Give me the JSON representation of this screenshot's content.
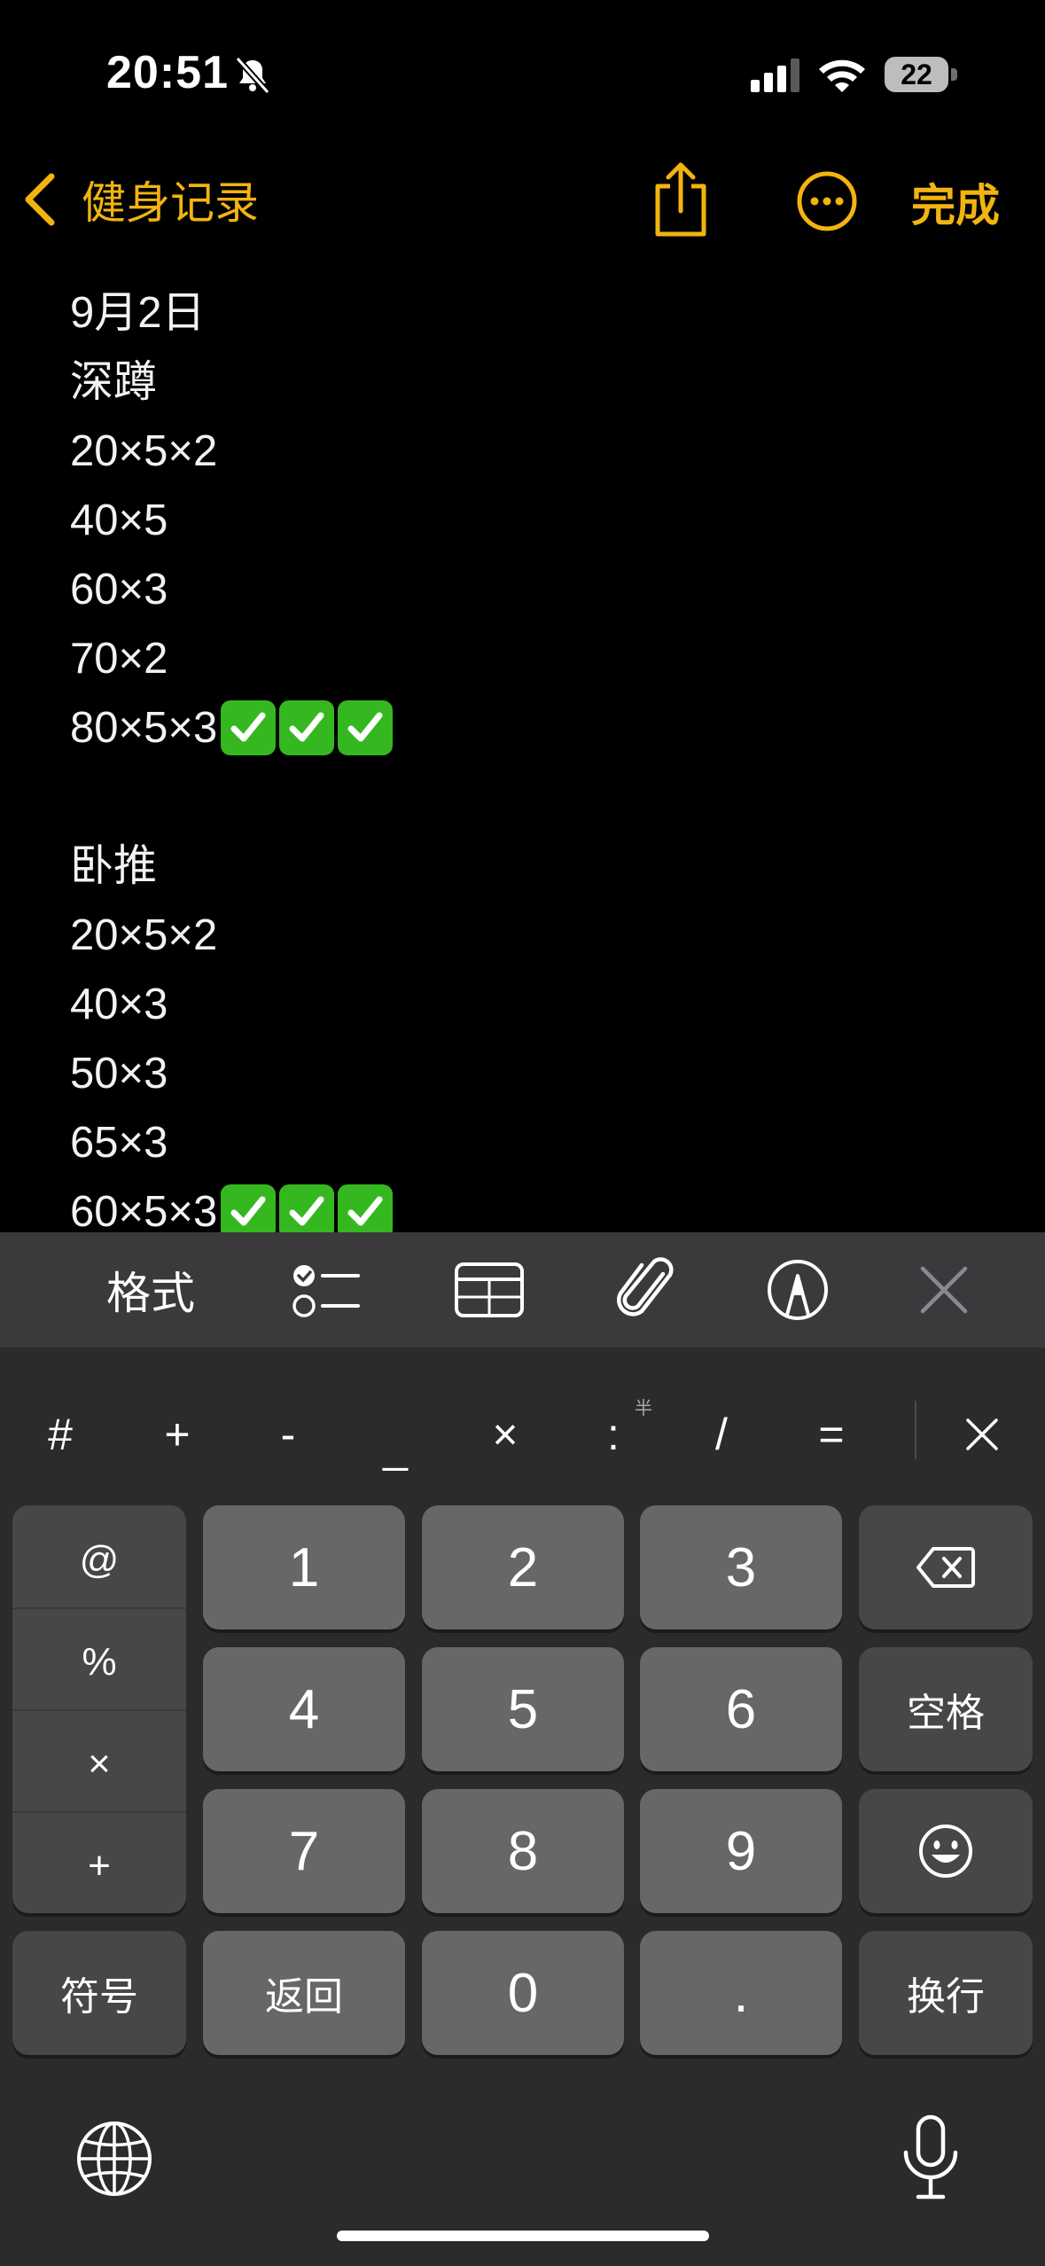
{
  "status_bar": {
    "time": "20:51",
    "battery": "22"
  },
  "nav": {
    "back_label": "健身记录",
    "done_label": "完成"
  },
  "note": {
    "lines": [
      {
        "text": "9月2日",
        "checks": 0
      },
      {
        "text": "深蹲",
        "checks": 0
      },
      {
        "text": "20×5×2",
        "checks": 0
      },
      {
        "text": "40×5",
        "checks": 0
      },
      {
        "text": "60×3",
        "checks": 0
      },
      {
        "text": "70×2",
        "checks": 0
      },
      {
        "text": "80×5×3",
        "checks": 3
      },
      {
        "text": "",
        "checks": 0
      },
      {
        "text": "卧推",
        "checks": 0
      },
      {
        "text": "20×5×2",
        "checks": 0
      },
      {
        "text": "40×3",
        "checks": 0
      },
      {
        "text": "50×3",
        "checks": 0
      },
      {
        "text": "65×3",
        "checks": 0
      },
      {
        "text": "60×5×3",
        "checks": 3
      }
    ]
  },
  "toolbar": {
    "format_label": "格式"
  },
  "keyboard": {
    "symbols": [
      "#",
      "+",
      "-",
      "_",
      "×",
      ":",
      "/",
      "="
    ],
    "colon_hint": "半",
    "side": [
      "@",
      "%",
      "×",
      "+"
    ],
    "digits": [
      "1",
      "2",
      "3",
      "4",
      "5",
      "6",
      "7",
      "8",
      "9",
      "0"
    ],
    "space_label": "空格",
    "symbol_label": "符号",
    "return_label": "返回",
    "dot_label": ".",
    "newline_label": "换行"
  },
  "colors": {
    "accent": "#f2b40f",
    "check_green": "#35b81f"
  },
  "icons": [
    "bell-slash-icon",
    "cellular-icon",
    "wifi-icon",
    "battery-icon",
    "chevron-left-icon",
    "share-icon",
    "more-icon",
    "checklist-icon",
    "table-icon",
    "paperclip-icon",
    "markup-pen-icon",
    "close-icon",
    "backspace-icon",
    "emoji-icon",
    "globe-icon",
    "microphone-icon"
  ]
}
